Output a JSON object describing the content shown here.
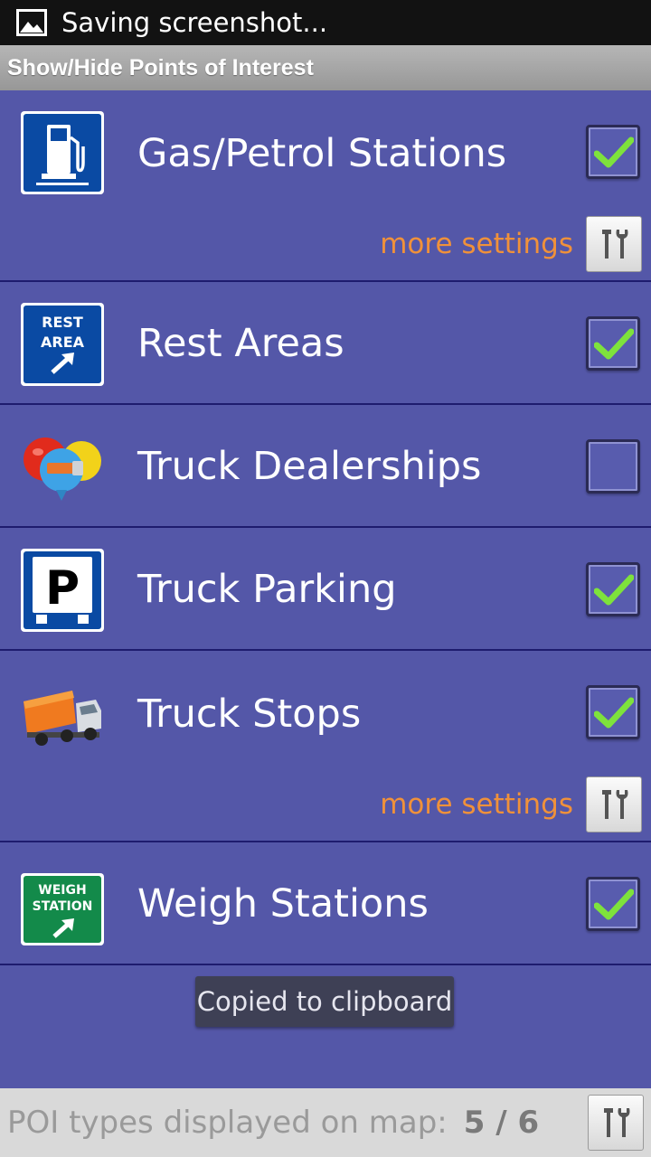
{
  "status_bar": {
    "text": "Saving screenshot...",
    "icon": "image-icon"
  },
  "header": {
    "title": "Show/Hide Points of Interest"
  },
  "items": [
    {
      "label": "Gas/Petrol Stations",
      "checked": true,
      "icon": "gas-station-icon",
      "settings_label": "more settings"
    },
    {
      "label": "Rest Areas",
      "checked": true,
      "icon": "rest-area-icon",
      "icon_text_1": "REST",
      "icon_text_2": "AREA"
    },
    {
      "label": "Truck Dealerships",
      "checked": false,
      "icon": "dealership-balloons-icon"
    },
    {
      "label": "Truck Parking",
      "checked": true,
      "icon": "truck-parking-icon",
      "icon_text": "P"
    },
    {
      "label": "Truck Stops",
      "checked": true,
      "icon": "truck-icon",
      "settings_label": "more settings"
    },
    {
      "label": "Weigh Stations",
      "checked": true,
      "icon": "weigh-station-icon",
      "icon_text_1": "WEIGH",
      "icon_text_2": "STATION"
    }
  ],
  "toast": {
    "text": "Copied to clipboard"
  },
  "footer": {
    "label": "POI types displayed on map:",
    "count": "5 / 6"
  },
  "colors": {
    "background": "#5457a8",
    "settings_link": "#f0913a",
    "check": "#7ee23c",
    "header": "#a7a7a7"
  }
}
